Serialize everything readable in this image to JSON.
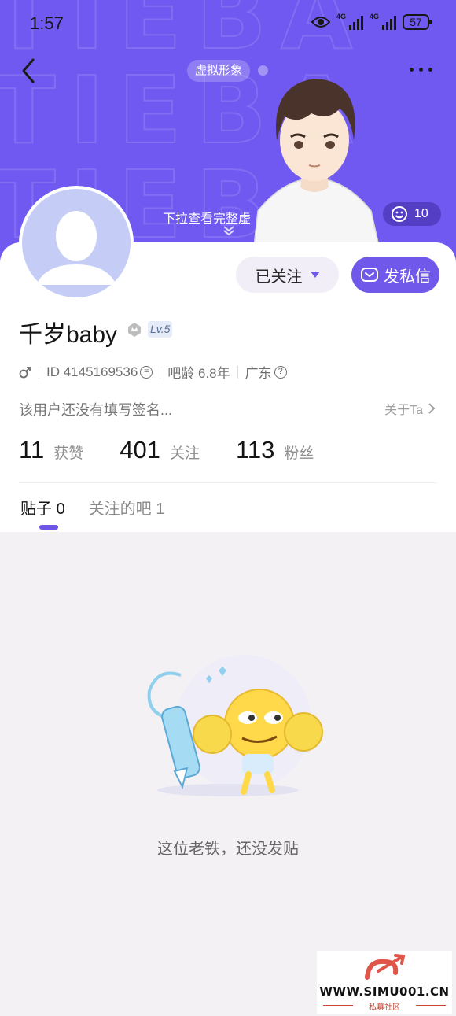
{
  "status_bar": {
    "time": "1:57",
    "battery": "57",
    "network_1": "4G",
    "network_2": "4G"
  },
  "header": {
    "virtual_tag": "虚拟形象",
    "pull_hint": "下拉查看完整虚",
    "like_count": "10"
  },
  "profile": {
    "name": "千岁baby",
    "level": "Lv.5",
    "user_id": "ID 4145169536",
    "bar_age": "吧龄 6.8年",
    "location": "广东",
    "signature": "该用户还没有填写签名...",
    "about_link": "关于Ta"
  },
  "actions": {
    "follow_label": "已关注",
    "message_label": "发私信"
  },
  "stats": [
    {
      "num": "11",
      "label": "获赞"
    },
    {
      "num": "401",
      "label": "关注"
    },
    {
      "num": "113",
      "label": "粉丝"
    }
  ],
  "tabs": [
    {
      "label": "贴子",
      "count": "0"
    },
    {
      "label": "关注的吧",
      "count": "1"
    }
  ],
  "empty": {
    "text": "这位老铁，还没发贴"
  },
  "watermark": {
    "url": "WWW.SIMU001.CN",
    "sub": "私募社区"
  },
  "colors": {
    "accent": "#7058ea",
    "hero_bg": "#7059f0",
    "page_bg": "#f4f1f5"
  },
  "icons": [
    "eye-icon",
    "signal-icon",
    "battery-icon",
    "back-arrow-icon",
    "more-icon",
    "smile-icon",
    "chevron-down-icon",
    "envelope-icon",
    "male-icon",
    "chevron-right-icon",
    "copy-icon",
    "question-icon"
  ]
}
